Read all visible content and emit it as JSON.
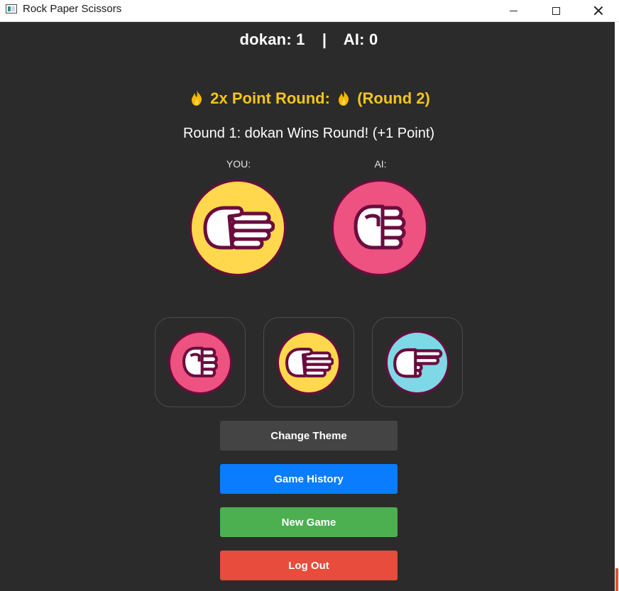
{
  "window": {
    "title": "Rock Paper Scissors",
    "controls": {
      "minimize": "minimize-icon",
      "maximize": "maximize-icon",
      "close": "close-icon"
    }
  },
  "scoreboard": {
    "player_name": "dokan",
    "player_score": "dokan: 1",
    "separator": "|",
    "ai_score": "AI: 0"
  },
  "round": {
    "bonus_text": "2x Point Round:",
    "bonus_round": "(Round 2)",
    "bonus_icon": "flame-icon",
    "result": "Round 1: dokan Wins Round! (+1 Point)"
  },
  "players": {
    "you_label": "YOU:",
    "ai_label": "AI:",
    "you_choice": "paper",
    "ai_choice": "rock"
  },
  "choices": [
    {
      "id": "rock",
      "icon": "rock-hand-icon",
      "color": "#ee5280"
    },
    {
      "id": "paper",
      "icon": "paper-hand-icon",
      "color": "#ffd84d"
    },
    {
      "id": "scissors",
      "icon": "scissors-hand-icon",
      "color": "#7ed8e6"
    }
  ],
  "actions": {
    "change_theme": "Change Theme",
    "game_history": "Game History",
    "new_game": "New Game",
    "log_out": "Log Out"
  },
  "colors": {
    "background": "#2b2b2b",
    "accent_gold": "#f5c518",
    "history_blue": "#0a7cff",
    "new_game_green": "#4caf50",
    "logout_red": "#e74c3c",
    "theme_gray": "#444444"
  }
}
